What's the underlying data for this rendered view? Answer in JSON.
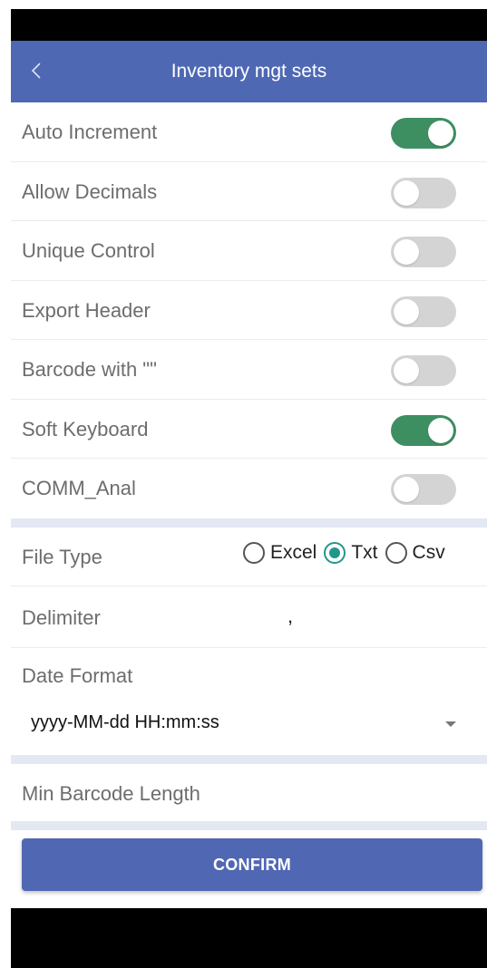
{
  "header": {
    "title": "Inventory mgt sets",
    "back_icon": "chevron-left-icon"
  },
  "toggles": [
    {
      "label": "Auto Increment",
      "on": true
    },
    {
      "label": "Allow Decimals",
      "on": false
    },
    {
      "label": "Unique Control",
      "on": false
    },
    {
      "label": "Export Header",
      "on": false
    },
    {
      "label": "Barcode with \"\"",
      "on": false
    },
    {
      "label": "Soft Keyboard",
      "on": true
    },
    {
      "label": "COMM_Anal",
      "on": false
    }
  ],
  "file_type": {
    "label": "File Type",
    "options": [
      "Excel",
      "Txt",
      "Csv"
    ],
    "selected": "Txt"
  },
  "delimiter": {
    "label": "Delimiter",
    "value": ","
  },
  "date_format": {
    "label": "Date Format",
    "value": "yyyy-MM-dd HH:mm:ss"
  },
  "min_barcode": {
    "label": "Min Barcode Length"
  },
  "confirm_label": "CONFIRM",
  "colors": {
    "app_bar": "#4e68b4",
    "toggle_on": "#3d8f62",
    "toggle_off": "#d4d4d4",
    "radio_selected": "#22968c",
    "separator": "#e3e8f3",
    "button": "#5067b3"
  }
}
